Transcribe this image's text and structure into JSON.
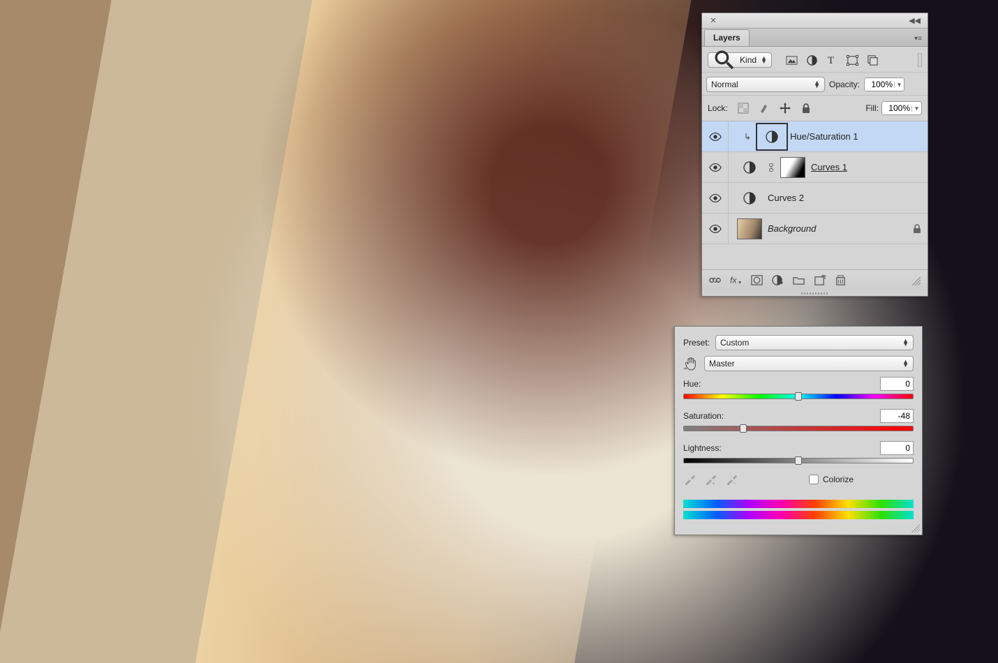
{
  "layersPanel": {
    "tabLabel": "Layers",
    "filterLabel": "Kind",
    "blendMode": "Normal",
    "opacityLabel": "Opacity:",
    "opacityValue": "100%",
    "lockLabel": "Lock:",
    "fillLabel": "Fill:",
    "fillValue": "100%",
    "layers": [
      {
        "name": "Hue/Saturation 1",
        "selected": true,
        "clipped": true
      },
      {
        "name": "Curves 1",
        "underline": true,
        "hasMask": true
      },
      {
        "name": "Curves 2"
      },
      {
        "name": "Background",
        "italic": true,
        "locked": true,
        "photoThumb": true
      }
    ]
  },
  "hueSat": {
    "presetLabel": "Preset:",
    "presetValue": "Custom",
    "channelValue": "Master",
    "hueLabel": "Hue:",
    "hueValue": "0",
    "huePct": 50,
    "satLabel": "Saturation:",
    "satValue": "-48",
    "satPct": 26,
    "lightLabel": "Lightness:",
    "lightValue": "0",
    "lightPct": 50,
    "colorizeLabel": "Colorize"
  }
}
